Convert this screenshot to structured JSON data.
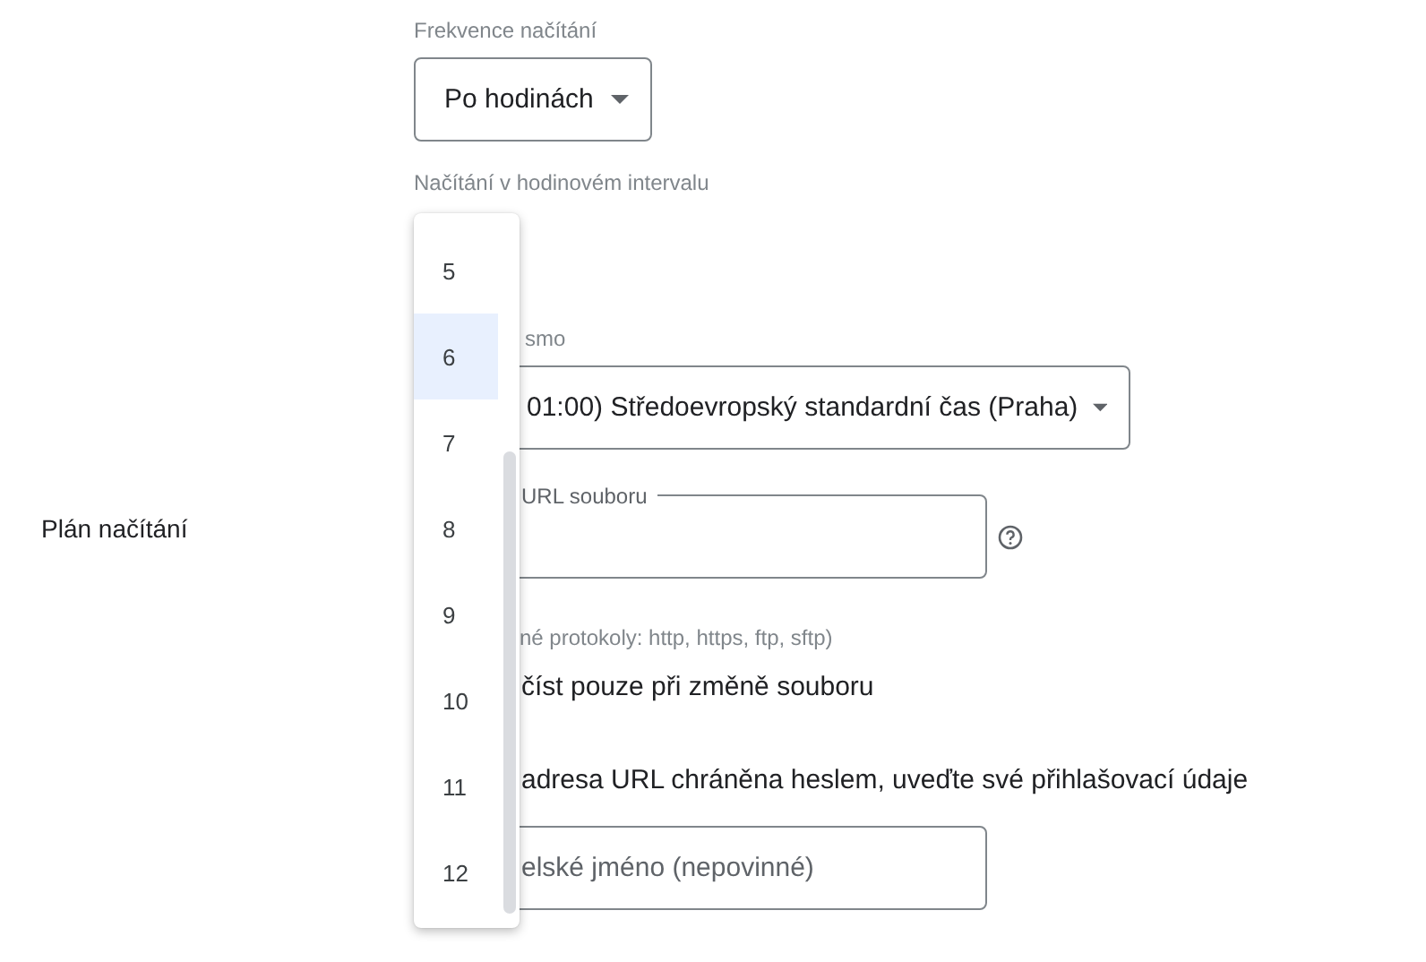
{
  "schedule_label": "Plán načítání",
  "frequency": {
    "label": "Frekvence načítání",
    "value": "Po hodinách"
  },
  "interval": {
    "label": "Načítání v hodinovém intervalu",
    "options": [
      {
        "label": "5",
        "selected": false
      },
      {
        "label": "6",
        "selected": true
      },
      {
        "label": "7",
        "selected": false
      },
      {
        "label": "8",
        "selected": false
      },
      {
        "label": "9",
        "selected": false
      },
      {
        "label": "10",
        "selected": false
      },
      {
        "label": "11",
        "selected": false
      },
      {
        "label": "12",
        "selected": false
      }
    ]
  },
  "timezone": {
    "label": "smo",
    "value": "01:00) Středoevropský standardní čas (Praha)"
  },
  "file_url": {
    "label": "URL souboru",
    "hint": "né protokoly: http, https, ftp, sftp)"
  },
  "fetch_only_on_change": {
    "label": "číst pouze při změně souboru"
  },
  "credentials_note": "adresa URL chráněna heslem, uveďte své přihlašovací údaje",
  "username": {
    "placeholder": "elské jméno (nepovinné)"
  }
}
